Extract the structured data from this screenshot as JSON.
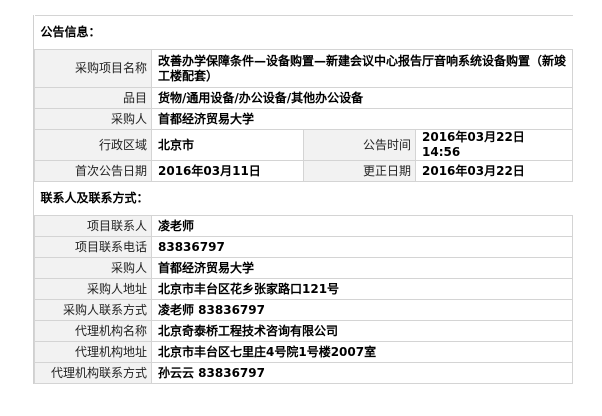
{
  "announcement": {
    "section_title": "公告信息：",
    "rows": {
      "project_name": {
        "label": "采购项目名称",
        "value": "改善办学保障条件—设备购置—新建会议中心报告厅音响系统设备购置（新竣工楼配套）"
      },
      "category": {
        "label": "品目",
        "value": "货物/通用设备/办公设备/其他办公设备"
      },
      "purchaser": {
        "label": "采购人",
        "value": "首都经济贸易大学"
      },
      "region": {
        "label": "行政区域",
        "value": "北京市"
      },
      "announce_time": {
        "label": "公告时间",
        "value": "2016年03月22日  14:56"
      },
      "first_date": {
        "label": "首次公告日期",
        "value": "2016年03月11日"
      },
      "update_date": {
        "label": "更正日期",
        "value": "2016年03月22日"
      }
    }
  },
  "contacts": {
    "section_title": "联系人及联系方式：",
    "rows": {
      "project_contact": {
        "label": "项目联系人",
        "value": "凌老师"
      },
      "project_phone": {
        "label": "项目联系电话",
        "value": "83836797"
      },
      "purchaser": {
        "label": "采购人",
        "value": "首都经济贸易大学"
      },
      "purchaser_address": {
        "label": "采购人地址",
        "value": "北京市丰台区花乡张家路口121号"
      },
      "purchaser_contact": {
        "label": "采购人联系方式",
        "value": "凌老师  83836797"
      },
      "agency_name": {
        "label": "代理机构名称",
        "value": "北京奇泰桥工程技术咨询有限公司"
      },
      "agency_address": {
        "label": "代理机构地址",
        "value": "北京市丰台区七里庄4号院1号楼2007室"
      },
      "agency_contact": {
        "label": "代理机构联系方式",
        "value": "孙云云  83836797"
      }
    }
  }
}
